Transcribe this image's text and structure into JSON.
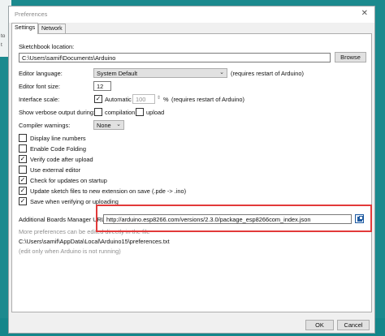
{
  "background": {
    "left_text": "to",
    "left_text2": "t"
  },
  "window": {
    "title": "Preferences",
    "close_glyph": "✕",
    "tabs": [
      {
        "label": "Settings"
      },
      {
        "label": "Network"
      }
    ]
  },
  "settings": {
    "sketchbook_label": "Sketchbook location:",
    "sketchbook_value": "C:\\Users\\samif\\Documents\\Arduino",
    "browse_label": "Browse",
    "editor_language_label": "Editor language:",
    "editor_language_value": "System Default",
    "editor_language_note": "(requires restart of Arduino)",
    "font_size_label": "Editor font size:",
    "font_size_value": "12",
    "interface_scale_label": "Interface scale:",
    "interface_scale_auto": "Automatic",
    "interface_scale_value": "100",
    "interface_scale_pct": "%",
    "interface_scale_note": "(requires restart of Arduino)",
    "verbose_label": "Show verbose output during:",
    "verbose_compilation": "compilation",
    "verbose_upload": "upload",
    "compiler_warnings_label": "Compiler warnings:",
    "compiler_warnings_value": "None",
    "checkboxes": [
      {
        "label": "Display line numbers",
        "checked": false
      },
      {
        "label": "Enable Code Folding",
        "checked": false
      },
      {
        "label": "Verify code after upload",
        "checked": true
      },
      {
        "label": "Use external editor",
        "checked": false
      },
      {
        "label": "Check for updates on startup",
        "checked": true
      },
      {
        "label": "Update sketch files to new extension on save (.pde -> .ino)",
        "checked": true
      },
      {
        "label": "Save when verifying or uploading",
        "checked": true
      }
    ],
    "boards_url_label": "Additional Boards Manager URLs:",
    "boards_url_value": "http://arduino.esp8266.com/versions/2.3.0/package_esp8266com_index.json",
    "more_prefs_note": "More preferences can be edited directly in the file",
    "prefs_path": "C:\\Users\\samif\\AppData\\Local\\Arduino15\\preferences.txt",
    "edit_note": "(edit only when Arduino is not running)",
    "check_glyph": "✓"
  },
  "footer": {
    "ok_label": "OK",
    "cancel_label": "Cancel"
  },
  "colors": {
    "highlight_box": "#e23a3a",
    "desktop": "#1b8a8e"
  }
}
